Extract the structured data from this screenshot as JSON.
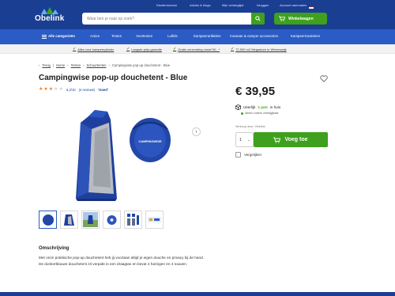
{
  "header": {
    "logo_text": "Obelink",
    "top_links": [
      "Klantenservice",
      "Advies & blogs",
      "Mijn verlanglijst",
      "Inloggen",
      "Account aanmaken"
    ],
    "search_placeholder": "Waar ben je naar op zoek?",
    "cart_label": "Winkelwagen"
  },
  "nav": {
    "items": [
      "Alle categorieën",
      "Acties",
      "Tenten",
      "Voortenten",
      "Luifels",
      "Kampeerartikelen",
      "Caravan & camper accessoires",
      "Kampeermeubelen"
    ]
  },
  "usp": {
    "items": [
      "Alles voor kampeerplezier",
      "Laagste-prijs-garantie",
      "Gratis verzending vanaf 50,- *",
      "72.500 m2 Megastore in Winterswijk"
    ]
  },
  "breadcrumb": {
    "items": [
      "Terug",
      "Home",
      "Tenten",
      "Schuurtenten",
      "Campingwise pop-up douchetent - Blue"
    ]
  },
  "product": {
    "title": "Campingwise pop-up douchetent - Blue",
    "rating": 3,
    "rating_max": 5,
    "score_text": "6,2/10",
    "reviews_text": "(4 reviews)",
    "verdict": "'Goed'",
    "bag_brand": "CAMPINGWISE",
    "description_title": "Omschrijving",
    "description_text": "Met onze praktische pop-up douchetent heb jij voortaan altijd je eigen douche en privacy bij de hand. De donkerblauwe douchetent zit verpakt in een draagtas en bevat 4 haringen en 4 touwen."
  },
  "buybox": {
    "price": "€ 39,95",
    "delivery_prefix": "Uiterlijk",
    "delivery_highlight": "1 juni",
    "delivery_suffix": "in huis",
    "online_note": "Alleen online verkrijgbaar",
    "stock_label": "Verkoop door: Obelink",
    "quantity": "1",
    "add_label": "Voeg toe",
    "compare_label": "Vergelijken"
  },
  "colors": {
    "header_bg": "#1a3e92",
    "nav_bg": "#2b5bc4",
    "accent_green": "#3ea01d",
    "star": "#f27a1a"
  }
}
